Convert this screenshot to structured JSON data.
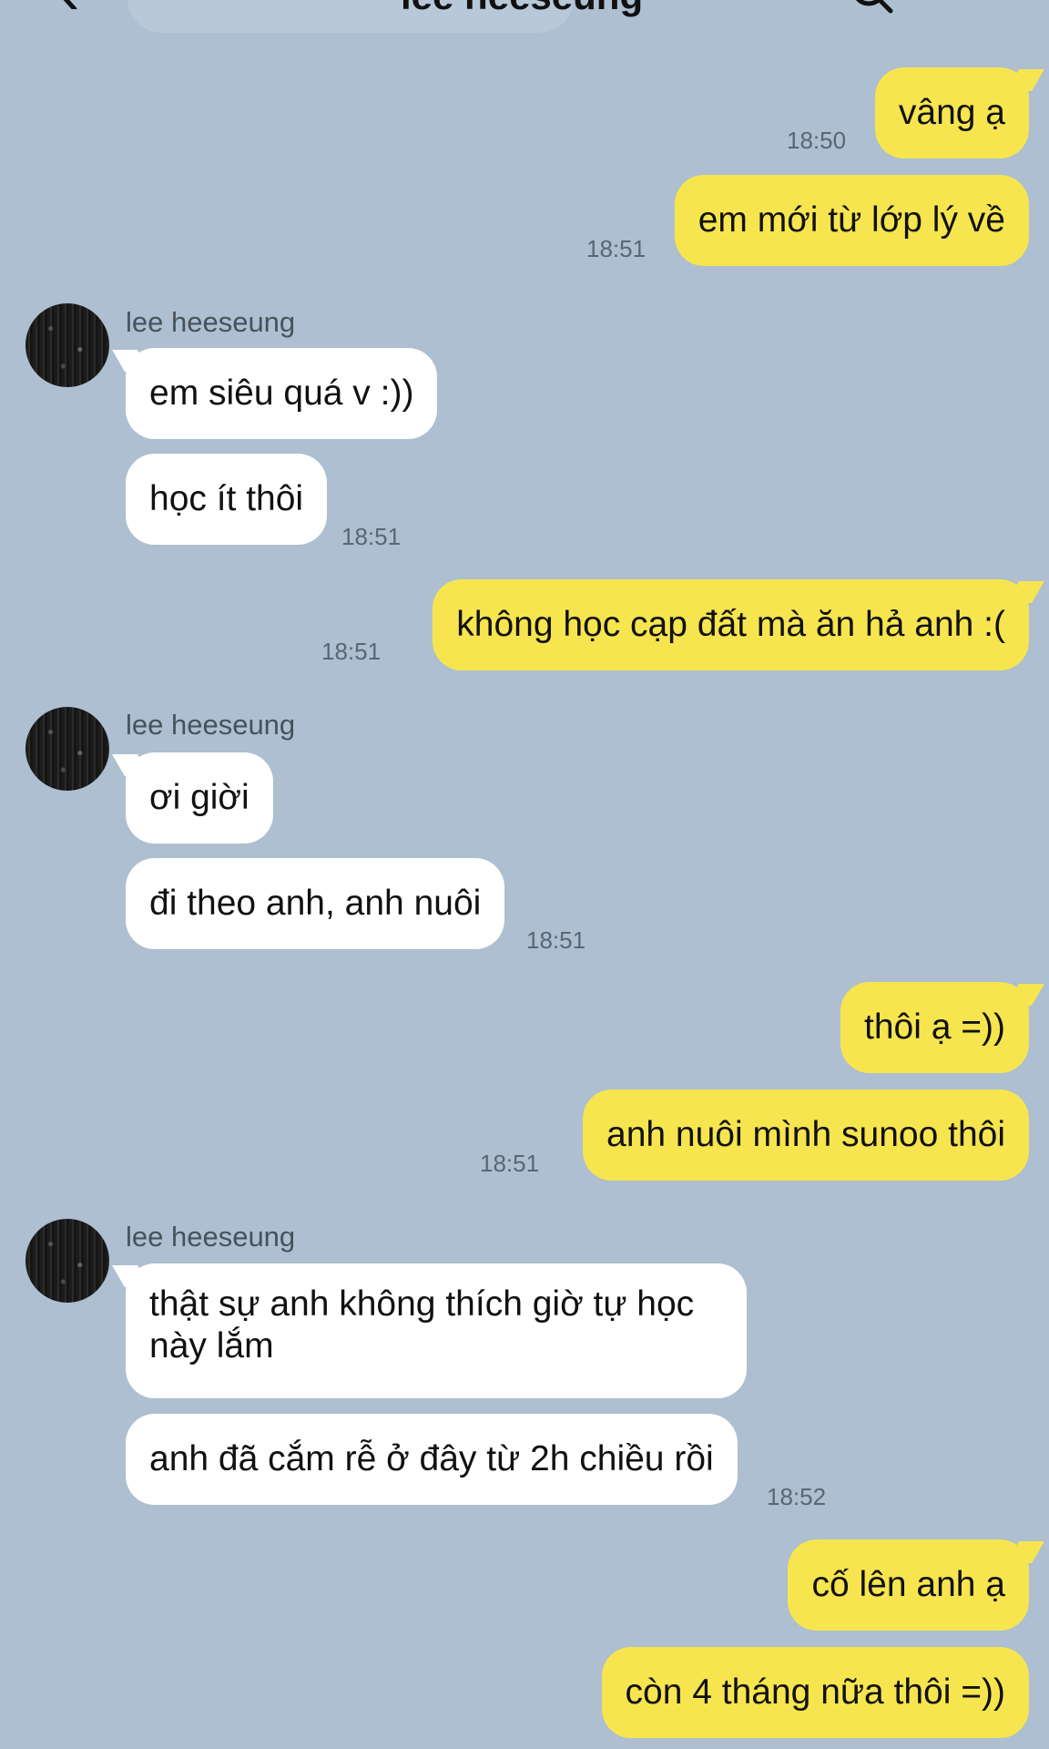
{
  "header": {
    "title": "lee heeseung"
  },
  "messages": [
    {
      "text": "vâng ạ",
      "time": "18:50"
    },
    {
      "text": "em mới từ lớp lý về",
      "time": "18:51"
    },
    {
      "sender": "lee heeseung"
    },
    {
      "text": "em siêu quá v :))"
    },
    {
      "text": "học ít thôi",
      "time": "18:51"
    },
    {
      "text": "không học cạp đất mà ăn hả anh :(",
      "time": "18:51"
    },
    {
      "sender": "lee heeseung"
    },
    {
      "text": "ơi giời"
    },
    {
      "text": "đi theo anh, anh nuôi",
      "time": "18:51"
    },
    {
      "text": "thôi ạ =))"
    },
    {
      "text": "anh nuôi mình sunoo thôi",
      "time": "18:51"
    },
    {
      "sender": "lee heeseung"
    },
    {
      "text": "thật sự anh không thích giờ tự học này lắm"
    },
    {
      "text": "anh đã cắm rễ ở đây từ 2h chiều rồi",
      "time": "18:52"
    },
    {
      "text": "cố lên anh ạ"
    },
    {
      "text": "còn 4 tháng nữa thôi =))"
    }
  ]
}
